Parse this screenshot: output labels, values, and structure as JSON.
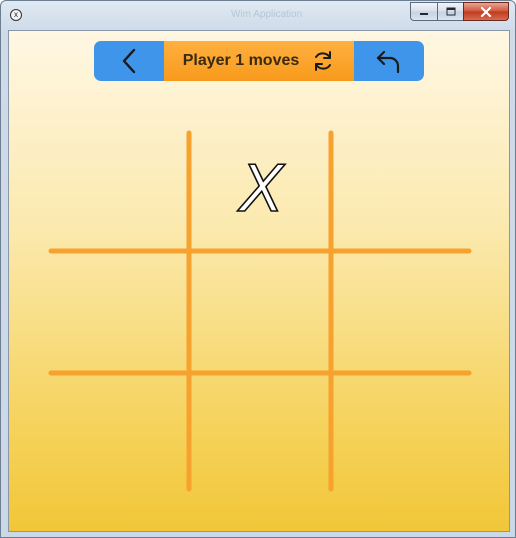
{
  "window": {
    "title": "Wim Application",
    "app_icon_glyph": "x"
  },
  "toolbar": {
    "back_icon": "chevron-left-icon",
    "status": "Player 1 moves",
    "restart_icon": "refresh-icon",
    "undo_icon": "undo-icon"
  },
  "board": {
    "rows": 3,
    "cols": 3,
    "cells": [
      [
        "",
        "X",
        ""
      ],
      [
        "",
        "",
        ""
      ],
      [
        "",
        "",
        ""
      ]
    ]
  },
  "colors": {
    "toolbar_button": "#3f95ea",
    "toolbar_status": "#f79a1c",
    "grid_line": "#f7a12e",
    "background_top": "#fff7e3",
    "background_bottom": "#f2c638"
  }
}
